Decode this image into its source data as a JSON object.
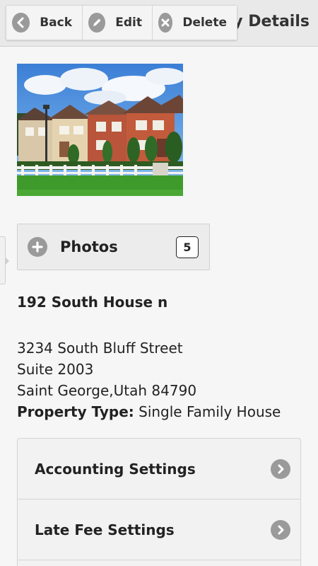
{
  "header": {
    "title": "Property Details",
    "back_label": "Back",
    "edit_label": "Edit",
    "delete_label": "Delete"
  },
  "photos": {
    "label": "Photos",
    "count": "5"
  },
  "property": {
    "name": "192 South House n",
    "address_line1": "3234 South Bluff Street",
    "address_line2": "Suite 2003",
    "city_state_zip": "Saint George,Utah 84790",
    "type_label": "Property Type:",
    "type_value": "Single Family House"
  },
  "settings": {
    "items": [
      {
        "label": "Accounting Settings"
      },
      {
        "label": "Late Fee Settings"
      }
    ]
  },
  "icons": {
    "back": "arrow-left-icon",
    "edit": "pencil-icon",
    "delete": "x-icon",
    "photos": "plus-icon",
    "settings": "chevron-right-icon"
  },
  "colors": {
    "header_bg": "#e9e9e9",
    "icon_gray": "#9a9a9a",
    "page_bg": "#f6f6f6"
  }
}
